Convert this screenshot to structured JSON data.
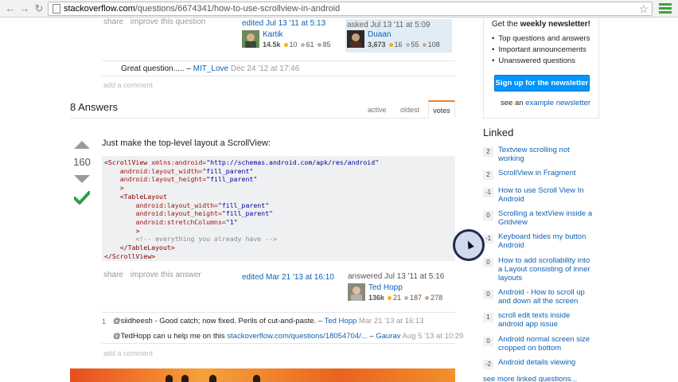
{
  "browser": {
    "url_host": "stackoverflow.com",
    "url_path": "/questions/6674341/how-to-use-scrollview-in-android"
  },
  "question": {
    "post_menu": [
      "share",
      "improve this question"
    ],
    "edited": {
      "time": "edited Jul 13 '11 at 5:13",
      "name": "Kartik",
      "rep": "14.5k",
      "gold": "10",
      "silver": "61",
      "bronze": "85"
    },
    "asked": {
      "time": "asked Jul 13 '11 at 5:09",
      "name": "Duaan",
      "rep": "3,673",
      "gold": "16",
      "silver": "55",
      "bronze": "108"
    },
    "comment": {
      "text": "Great question..... –",
      "user": "MIT_Love",
      "date": "Dec 24 '12 at 17:46"
    },
    "add_comment": "add a comment"
  },
  "answers_header": {
    "title": "8 Answers",
    "tabs": [
      "active",
      "oldest",
      "votes"
    ]
  },
  "answer": {
    "votes": "160",
    "text": "Just make the top-level layout a ScrollView:",
    "code": [
      "<ScrollView xmlns:android=\"http://schemas.android.com/apk/res/android\"",
      "    android:layout_width=\"fill_parent\"",
      "    android:layout_height=\"fill_parent\"",
      "    >",
      "    <TableLayout",
      "        android:layout_width=\"fill_parent\"",
      "        android:layout_height=\"fill_parent\"",
      "        android:stretchColumns=\"1\"",
      "        >",
      "        <!-- everything you already have -->",
      "    </TableLayout>",
      "</ScrollView>"
    ],
    "post_menu": [
      "share",
      "improve this answer"
    ],
    "edited": "edited Mar 21 '13 at 16:10",
    "answered": {
      "time": "answered Jul 13 '11 at 5:16",
      "name": "Ted Hopp",
      "rep": "136k",
      "gold": "21",
      "silver": "187",
      "bronze": "278"
    },
    "comments": [
      {
        "score": "1",
        "text": "@siidheesh - Good catch; now fixed. Perils of cut-and-paste. –",
        "user": "Ted Hopp",
        "date": "Mar 21 '13 at 16:13"
      },
      {
        "score": "",
        "text": "@TedHopp can u help me on this",
        "link": "stackoverflow.com/questions/18054704/...",
        "dash": "–",
        "user": "Gaurav",
        "date": "Aug 5 '13 at 10:29"
      }
    ],
    "add_comment": "add a comment"
  },
  "sidebar": {
    "newsletter": {
      "title_prefix": "Get the",
      "title_bold": "weekly newsletter!",
      "items": [
        "Top questions and answers",
        "Important announcements",
        "Unanswered questions"
      ],
      "button": "Sign up for the newsletter",
      "example_prefix": "see an",
      "example_link": "example newsletter"
    },
    "linked_title": "Linked",
    "linked": [
      {
        "count": "2",
        "title": "Textview scrolling not working"
      },
      {
        "count": "2",
        "title": "ScrollView in Fragment"
      },
      {
        "count": "-1",
        "title": "How to use Scroll View In Android"
      },
      {
        "count": "0",
        "title": "Scrolling a textView inside a Gridview"
      },
      {
        "count": "-1",
        "title": "Keyboard hides my button Android"
      },
      {
        "count": "0",
        "title": "How to add scrollability into a Layout consisting of inner layouts"
      },
      {
        "count": "0",
        "title": "Android - How to scroll up and down all the screen"
      },
      {
        "count": "1",
        "title": "scroll edit texts inside android app issue"
      },
      {
        "count": "0",
        "title": "Android normal screen size cropped on bottom"
      },
      {
        "count": "-2",
        "title": "Android details viewing"
      }
    ],
    "see_more": "see more linked questions..."
  },
  "colors": {
    "accent": "#0095ff",
    "link": "#0f60b6",
    "accepted": "#2ea043",
    "votes_tab": "#f48024"
  }
}
